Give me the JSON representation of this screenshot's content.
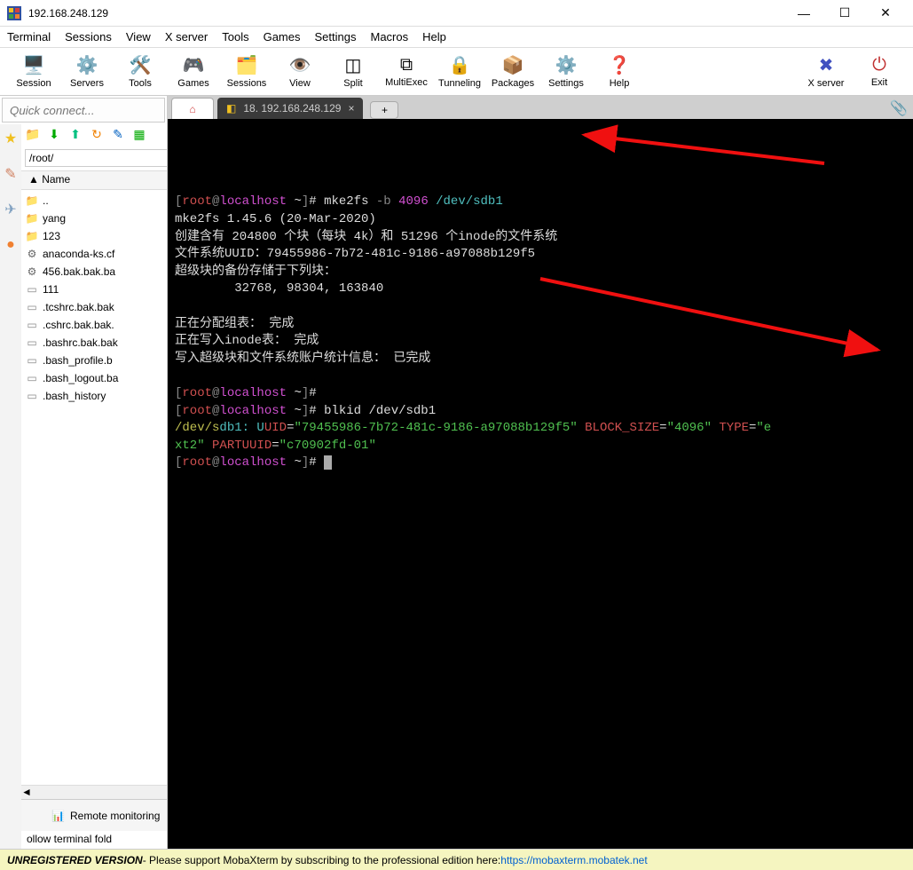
{
  "window": {
    "title": "192.168.248.129",
    "minimize": "—",
    "maximize": "☐",
    "close": "✕"
  },
  "menu": [
    "Terminal",
    "Sessions",
    "View",
    "X server",
    "Tools",
    "Games",
    "Settings",
    "Macros",
    "Help"
  ],
  "toolbar": [
    {
      "label": "Session",
      "icon": "🖥️",
      "name": "session"
    },
    {
      "label": "Servers",
      "icon": "⚙️",
      "name": "servers"
    },
    {
      "label": "Tools",
      "icon": "🛠️",
      "name": "tools"
    },
    {
      "label": "Games",
      "icon": "🎮",
      "name": "games"
    },
    {
      "label": "Sessions",
      "icon": "🗂️",
      "name": "sessions"
    },
    {
      "label": "View",
      "icon": "👁️",
      "name": "view"
    },
    {
      "label": "Split",
      "icon": "◫",
      "name": "split"
    },
    {
      "label": "MultiExec",
      "icon": "⧉",
      "name": "multiexec"
    },
    {
      "label": "Tunneling",
      "icon": "🔒",
      "name": "tunneling"
    },
    {
      "label": "Packages",
      "icon": "📦",
      "name": "packages"
    },
    {
      "label": "Settings",
      "icon": "⚙️",
      "name": "settings"
    },
    {
      "label": "Help",
      "icon": "❓",
      "name": "help"
    }
  ],
  "toolbar_right": [
    {
      "label": "X server",
      "icon": "✖",
      "name": "xserver"
    },
    {
      "label": "Exit",
      "icon": "⏻",
      "name": "exit"
    }
  ],
  "quick_connect_placeholder": "Quick connect...",
  "side_icons": [
    {
      "glyph": "★",
      "color": "#f0c020",
      "name": "favorites"
    },
    {
      "glyph": "✎",
      "color": "#d08060",
      "name": "edit"
    },
    {
      "glyph": "✈",
      "color": "#80a0c0",
      "name": "send"
    },
    {
      "glyph": "●",
      "color": "#f08030",
      "name": "globe"
    }
  ],
  "side_toolbar": [
    {
      "glyph": "📁",
      "name": "folder"
    },
    {
      "glyph": "⬇",
      "name": "download",
      "color": "#0a0"
    },
    {
      "glyph": "⬆",
      "name": "upload",
      "color": "#00c080"
    },
    {
      "glyph": "↻",
      "name": "refresh",
      "color": "#f08000"
    },
    {
      "glyph": "✎",
      "name": "edit",
      "color": "#0060c0"
    },
    {
      "glyph": "▦",
      "name": "grid",
      "color": "#0a0"
    }
  ],
  "path": "/root/",
  "file_header": "▲   Name",
  "files": [
    {
      "name": "..",
      "icon": "folder",
      "cls": "teal-icon"
    },
    {
      "name": "yang",
      "icon": "folder",
      "cls": "folder-icon"
    },
    {
      "name": "123",
      "icon": "folder",
      "cls": "folder-icon"
    },
    {
      "name": "anaconda-ks.cf",
      "icon": "gear",
      "cls": "gear-icon"
    },
    {
      "name": "456.bak.bak.ba",
      "icon": "gear",
      "cls": "gear-icon"
    },
    {
      "name": "111",
      "icon": "file",
      "cls": "file-icon"
    },
    {
      "name": ".tcshrc.bak.bak",
      "icon": "file",
      "cls": "file-icon"
    },
    {
      "name": ".cshrc.bak.bak.",
      "icon": "file",
      "cls": "file-icon"
    },
    {
      "name": ".bashrc.bak.bak",
      "icon": "file",
      "cls": "file-icon"
    },
    {
      "name": ".bash_profile.b",
      "icon": "file",
      "cls": "file-icon"
    },
    {
      "name": ".bash_logout.ba",
      "icon": "file",
      "cls": "file-icon"
    },
    {
      "name": ".bash_history",
      "icon": "file",
      "cls": "file-icon"
    }
  ],
  "remote_monitoring": "Remote monitoring",
  "bottom_option": "ollow terminal fold",
  "tabs": {
    "home_icon": "⌂",
    "active_icon": "◧",
    "active_label": "18. 192.168.248.129",
    "close": "×",
    "add": "+"
  },
  "terminal": {
    "prompt_parts": {
      "bracket_open": "[",
      "user": "root",
      "at": "@",
      "host": "localhost",
      "dir": " ~",
      "bracket_close": "]",
      "hash": "# "
    },
    "lines": [
      {
        "type": "prompt",
        "cmd_parts": [
          {
            "t": "mke2fs ",
            "c": "white"
          },
          {
            "t": "-b ",
            "c": "gray"
          },
          {
            "t": "4096 ",
            "c": "magenta"
          },
          {
            "t": "/dev/sdb1",
            "c": "cyan"
          }
        ]
      },
      {
        "type": "out",
        "t": "mke2fs 1.45.6 (20-Mar-2020)"
      },
      {
        "type": "out",
        "t": "创建含有 204800 个块（每块 4k）和 51296 个inode的文件系统"
      },
      {
        "type": "out",
        "t": "文件系统UUID：79455986-7b72-481c-9186-a97088b129f5"
      },
      {
        "type": "out",
        "t": "超级块的备份存储于下列块："
      },
      {
        "type": "out",
        "t": "        32768, 98304, 163840"
      },
      {
        "type": "blank"
      },
      {
        "type": "out",
        "t": "正在分配组表： 完成"
      },
      {
        "type": "out",
        "t": "正在写入inode表： 完成"
      },
      {
        "type": "out",
        "t": "写入超级块和文件系统账户统计信息： 已完成"
      },
      {
        "type": "blank"
      },
      {
        "type": "prompt",
        "cmd_parts": []
      },
      {
        "type": "prompt",
        "cmd_parts": [
          {
            "t": "blkid /dev/sdb1",
            "c": "white"
          }
        ]
      },
      {
        "type": "blkid"
      },
      {
        "type": "prompt_cursor"
      }
    ],
    "blkid": {
      "p1": "/dev/s",
      "p2": "db1: U",
      "p3": "UID",
      "eq1": "=",
      "uuid": "\"79455986-7b72-481c-9186-a97088b129f5\"",
      "bs_key": " BLOCK_SIZE",
      "eq2": "=",
      "bs_val": "\"4096\"",
      "type_key": " TYPE",
      "eq3": "=",
      "type_val_a": "\"e",
      "type_val_b": "xt2\"",
      "pu_key": " PARTUUID",
      "eq4": "=",
      "pu_val": "\"c70902fd-01\""
    }
  },
  "footer": {
    "strong": "UNREGISTERED VERSION",
    "text": "  -  Please support MobaXterm by subscribing to the professional edition here:  ",
    "link": "https://mobaxterm.mobatek.net"
  }
}
